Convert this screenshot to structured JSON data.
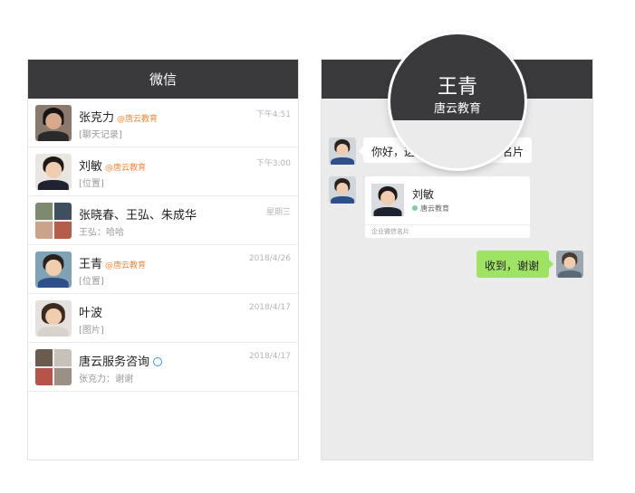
{
  "left_phone": {
    "title": "微信",
    "chats": [
      {
        "name": "张克力",
        "org": "@唐云教育",
        "time": "下午4:51",
        "preview": "[聊天记录]",
        "avatar": "man-cap"
      },
      {
        "name": "刘敏",
        "org": "@唐云教育",
        "time": "下午3:00",
        "preview": "[位置]",
        "avatar": "woman-suit"
      },
      {
        "name": "张晓春、王弘、朱成华",
        "org": "",
        "time": "星期三",
        "preview": "王弘：哈哈",
        "avatar": "group"
      },
      {
        "name": "王青",
        "org": "@唐云教育",
        "time": "2018/4/26",
        "preview": "[位置]",
        "avatar": "woman-blue"
      },
      {
        "name": "叶波",
        "org": "",
        "time": "2018/4/17",
        "preview": "[图片]",
        "avatar": "woman-portrait"
      },
      {
        "name": "唐云服务咨询",
        "org": "",
        "time": "2018/4/17",
        "preview": "张克力：谢谢",
        "avatar": "group",
        "icon": "chat-bubble-icon"
      }
    ]
  },
  "right_phone": {
    "header_name": "王青",
    "header_org": "唐云教育",
    "msg1_text": "你好，这",
    "msg1_tail": "名片",
    "card": {
      "name": "刘敏",
      "org": "唐云教育",
      "footer": "企业微信名片"
    },
    "reply_text": "收到，谢谢"
  },
  "colors": {
    "titlebar": "#3a3a3c",
    "org_accent": "#f08a3c",
    "reply_bubble": "#9fe365"
  }
}
